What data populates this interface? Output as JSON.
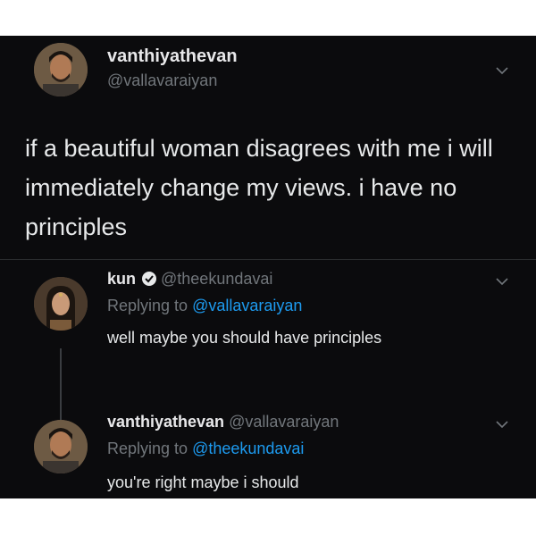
{
  "tweet1": {
    "display_name": "vanthiyathevan",
    "handle": "@vallavaraiyan",
    "text": "if a beautiful woman disagrees with me i will immediately change my views. i have no principles"
  },
  "tweet2": {
    "display_name": "kun",
    "handle": "@theekundavai",
    "replying_prefix": "Replying to ",
    "replying_to": "@vallavaraiyan",
    "text": "well maybe you should have principles"
  },
  "tweet3": {
    "display_name": "vanthiyathevan",
    "handle": "@vallavaraiyan",
    "replying_prefix": "Replying to ",
    "replying_to": "@theekundavai",
    "text": "you're right maybe i should"
  },
  "colors": {
    "background": "#0b0b0d",
    "text": "#e7e9ea",
    "secondary": "#71767b",
    "link": "#1d9bf0"
  }
}
